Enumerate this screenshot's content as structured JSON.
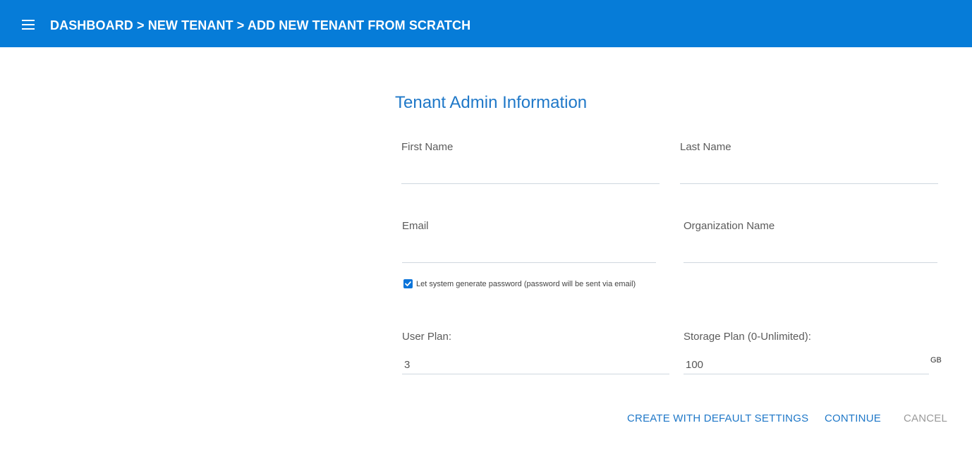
{
  "header": {
    "breadcrumb": "DASHBOARD > NEW TENANT > ADD NEW TENANT FROM SCRATCH",
    "menu_icon": "hamburger-menu-icon",
    "background_color": "#067cd8"
  },
  "form": {
    "title": "Tenant Admin Information",
    "first_name": {
      "label": "First Name",
      "value": ""
    },
    "last_name": {
      "label": "Last Name",
      "value": ""
    },
    "email": {
      "label": "Email",
      "value": ""
    },
    "organization_name": {
      "label": "Organization Name",
      "value": ""
    },
    "generate_password": {
      "label": "Let system generate password (password will be sent via email)",
      "checked": true
    },
    "user_plan": {
      "label": "User Plan:",
      "value": "3"
    },
    "storage_plan": {
      "label": "Storage Plan (0-Unlimited):",
      "value": "100",
      "unit": "GB"
    }
  },
  "actions": {
    "create_default": "CREATE WITH DEFAULT SETTINGS",
    "continue": "CONTINUE",
    "cancel": "CANCEL"
  },
  "colors": {
    "accent": "#1f78c8",
    "muted": "#9a9a9a"
  }
}
